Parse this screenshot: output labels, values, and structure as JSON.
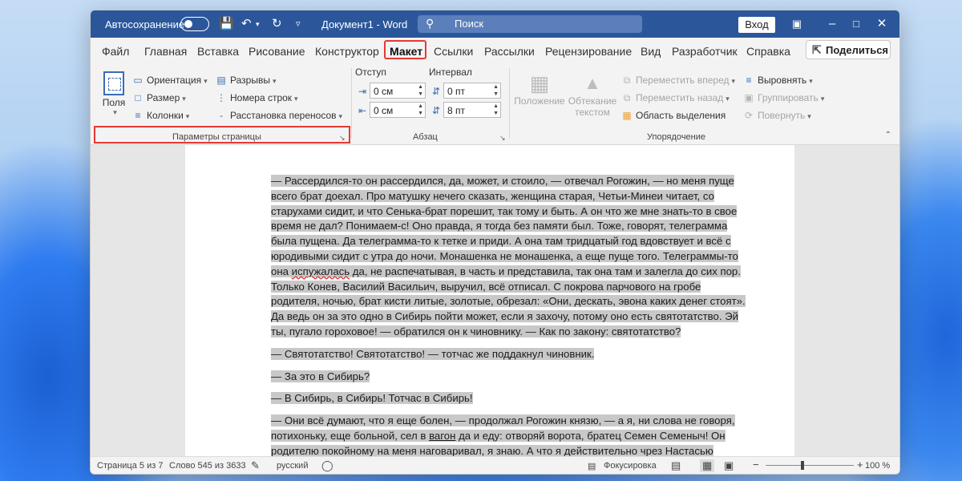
{
  "titlebar": {
    "autosave_label": "Автосохранение",
    "doc_title": "Документ1 - Word",
    "search_placeholder": "Поиск",
    "signin_label": "Вход"
  },
  "tabs": [
    "Файл",
    "Главная",
    "Вставка",
    "Рисование",
    "Конструктор",
    "Макет",
    "Ссылки",
    "Рассылки",
    "Рецензирование",
    "Вид",
    "Разработчик",
    "Справка"
  ],
  "share_label": "Поделиться",
  "ribbon": {
    "page_setup": {
      "fields_label": "Поля",
      "orientation": "Ориентация",
      "size": "Размер",
      "columns": "Колонки",
      "breaks": "Разрывы",
      "line_numbers": "Номера строк",
      "hyphenation": "Расстановка переносов",
      "group_label": "Параметры страницы"
    },
    "paragraph": {
      "indent_label": "Отступ",
      "spacing_label": "Интервал",
      "indent_left": "0 см",
      "indent_right": "0 см",
      "spacing_before": "0 пт",
      "spacing_after": "8 пт",
      "group_label": "Абзац"
    },
    "arrange": {
      "position": "Положение",
      "wrap_text_1": "Обтекание",
      "wrap_text_2": "текстом",
      "bring_forward": "Переместить вперед",
      "send_backward": "Переместить назад",
      "selection_pane": "Область выделения",
      "align": "Выровнять",
      "group": "Группировать",
      "rotate": "Повернуть",
      "group_label": "Упорядочение"
    }
  },
  "document": {
    "p1_a": "— Рассердился-то он рассердился, да, может, и стоило, — отвечал Рогожин, — но меня пуще всего брат доехал. Про матушку нечего сказать, женщина старая, Четьи-Минеи читает, со старухами сидит, и что Сенька-брат порешит, так тому и быть. А он что же мне знать-то в свое время не дал? Понимаем-с! Оно правда, я тогда без памяти был. Тоже, говорят, телеграмма была пущена. Да телеграмма-то к тетке и приди. А она там тридцатый год вдовствует и всё с юродивыми сидит с утра до ночи. Монашенка не монашенка, а еще пуще того. Телеграммы-то она ",
    "p1_squiggle": "испужалась",
    "p1_b": " да, не распечатывая, в часть и представила, так она там и залегла до сих пор. Только Конев, Василий Васильич, выручил, всё отписал. С покрова парчового на гробе родителя, ночью, брат кисти литые, золотые, обрезал: «Они, дескать, эвона каких денег стоят». Да ведь он за это одно в Сибирь пойти может, если я захочу, потому оно есть святотатство. Эй ты, пугало гороховое! — обратился он к чиновнику. — Как по закону: святотатство?",
    "p2": "— Святотатство! Святотатство! — тотчас же поддакнул чиновник.",
    "p3": "— За это в Сибирь?",
    "p4": "— В Сибирь, в Сибирь! Тотчас в Сибирь!",
    "p5_a": "— Они всё думают, что я еще болен, — продолжал Рогожин князю, — а я, ни слова не говоря, потихоньку, еще больной, сел в ",
    "p5_link": "вагон",
    "p5_b": " да и еду: отворяй ворота, братец Семен Семеныч! Он родителю покойному на меня наговаривал, я знаю. А что я действительно чрез Настасью Филипповну тогда родителя раздражил, так это правда. Тут уж я один. Попутал грех."
  },
  "statusbar": {
    "page": "Страница 5 из 7",
    "words": "Слово 545 из 3633",
    "language": "русский",
    "focus": "Фокусировка",
    "zoom": "100 %",
    "zoom_fraction": 0.42
  }
}
